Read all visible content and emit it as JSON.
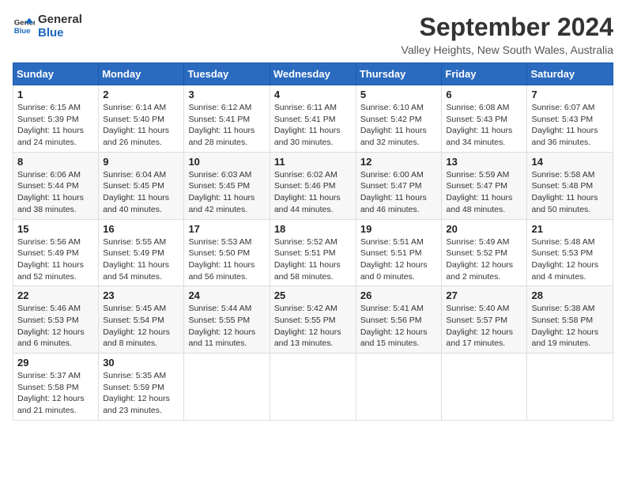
{
  "logo": {
    "general": "General",
    "blue": "Blue"
  },
  "title": "September 2024",
  "subtitle": "Valley Heights, New South Wales, Australia",
  "headers": [
    "Sunday",
    "Monday",
    "Tuesday",
    "Wednesday",
    "Thursday",
    "Friday",
    "Saturday"
  ],
  "weeks": [
    [
      {
        "day": "1",
        "info": "Sunrise: 6:15 AM\nSunset: 5:39 PM\nDaylight: 11 hours\nand 24 minutes."
      },
      {
        "day": "2",
        "info": "Sunrise: 6:14 AM\nSunset: 5:40 PM\nDaylight: 11 hours\nand 26 minutes."
      },
      {
        "day": "3",
        "info": "Sunrise: 6:12 AM\nSunset: 5:41 PM\nDaylight: 11 hours\nand 28 minutes."
      },
      {
        "day": "4",
        "info": "Sunrise: 6:11 AM\nSunset: 5:41 PM\nDaylight: 11 hours\nand 30 minutes."
      },
      {
        "day": "5",
        "info": "Sunrise: 6:10 AM\nSunset: 5:42 PM\nDaylight: 11 hours\nand 32 minutes."
      },
      {
        "day": "6",
        "info": "Sunrise: 6:08 AM\nSunset: 5:43 PM\nDaylight: 11 hours\nand 34 minutes."
      },
      {
        "day": "7",
        "info": "Sunrise: 6:07 AM\nSunset: 5:43 PM\nDaylight: 11 hours\nand 36 minutes."
      }
    ],
    [
      {
        "day": "8",
        "info": "Sunrise: 6:06 AM\nSunset: 5:44 PM\nDaylight: 11 hours\nand 38 minutes."
      },
      {
        "day": "9",
        "info": "Sunrise: 6:04 AM\nSunset: 5:45 PM\nDaylight: 11 hours\nand 40 minutes."
      },
      {
        "day": "10",
        "info": "Sunrise: 6:03 AM\nSunset: 5:45 PM\nDaylight: 11 hours\nand 42 minutes."
      },
      {
        "day": "11",
        "info": "Sunrise: 6:02 AM\nSunset: 5:46 PM\nDaylight: 11 hours\nand 44 minutes."
      },
      {
        "day": "12",
        "info": "Sunrise: 6:00 AM\nSunset: 5:47 PM\nDaylight: 11 hours\nand 46 minutes."
      },
      {
        "day": "13",
        "info": "Sunrise: 5:59 AM\nSunset: 5:47 PM\nDaylight: 11 hours\nand 48 minutes."
      },
      {
        "day": "14",
        "info": "Sunrise: 5:58 AM\nSunset: 5:48 PM\nDaylight: 11 hours\nand 50 minutes."
      }
    ],
    [
      {
        "day": "15",
        "info": "Sunrise: 5:56 AM\nSunset: 5:49 PM\nDaylight: 11 hours\nand 52 minutes."
      },
      {
        "day": "16",
        "info": "Sunrise: 5:55 AM\nSunset: 5:49 PM\nDaylight: 11 hours\nand 54 minutes."
      },
      {
        "day": "17",
        "info": "Sunrise: 5:53 AM\nSunset: 5:50 PM\nDaylight: 11 hours\nand 56 minutes."
      },
      {
        "day": "18",
        "info": "Sunrise: 5:52 AM\nSunset: 5:51 PM\nDaylight: 11 hours\nand 58 minutes."
      },
      {
        "day": "19",
        "info": "Sunrise: 5:51 AM\nSunset: 5:51 PM\nDaylight: 12 hours\nand 0 minutes."
      },
      {
        "day": "20",
        "info": "Sunrise: 5:49 AM\nSunset: 5:52 PM\nDaylight: 12 hours\nand 2 minutes."
      },
      {
        "day": "21",
        "info": "Sunrise: 5:48 AM\nSunset: 5:53 PM\nDaylight: 12 hours\nand 4 minutes."
      }
    ],
    [
      {
        "day": "22",
        "info": "Sunrise: 5:46 AM\nSunset: 5:53 PM\nDaylight: 12 hours\nand 6 minutes."
      },
      {
        "day": "23",
        "info": "Sunrise: 5:45 AM\nSunset: 5:54 PM\nDaylight: 12 hours\nand 8 minutes."
      },
      {
        "day": "24",
        "info": "Sunrise: 5:44 AM\nSunset: 5:55 PM\nDaylight: 12 hours\nand 11 minutes."
      },
      {
        "day": "25",
        "info": "Sunrise: 5:42 AM\nSunset: 5:55 PM\nDaylight: 12 hours\nand 13 minutes."
      },
      {
        "day": "26",
        "info": "Sunrise: 5:41 AM\nSunset: 5:56 PM\nDaylight: 12 hours\nand 15 minutes."
      },
      {
        "day": "27",
        "info": "Sunrise: 5:40 AM\nSunset: 5:57 PM\nDaylight: 12 hours\nand 17 minutes."
      },
      {
        "day": "28",
        "info": "Sunrise: 5:38 AM\nSunset: 5:58 PM\nDaylight: 12 hours\nand 19 minutes."
      }
    ],
    [
      {
        "day": "29",
        "info": "Sunrise: 5:37 AM\nSunset: 5:58 PM\nDaylight: 12 hours\nand 21 minutes."
      },
      {
        "day": "30",
        "info": "Sunrise: 5:35 AM\nSunset: 5:59 PM\nDaylight: 12 hours\nand 23 minutes."
      },
      {
        "day": "",
        "info": ""
      },
      {
        "day": "",
        "info": ""
      },
      {
        "day": "",
        "info": ""
      },
      {
        "day": "",
        "info": ""
      },
      {
        "day": "",
        "info": ""
      }
    ]
  ]
}
